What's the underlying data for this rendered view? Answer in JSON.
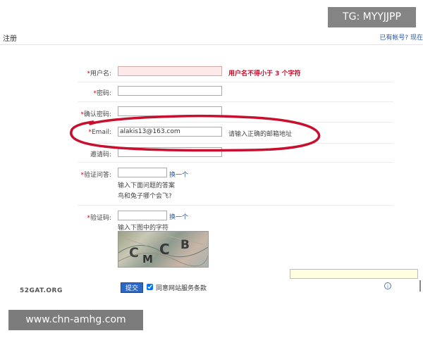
{
  "header": {
    "title": "注册",
    "links": "已有帐号? 现在"
  },
  "form": {
    "username": {
      "label": "用户名:",
      "required": "*",
      "value": "",
      "error": "用户名不得小于 3 个字符"
    },
    "password": {
      "label": "密码:",
      "required": "*",
      "value": ""
    },
    "confirm": {
      "label": "确认密码:",
      "required": "*",
      "value": ""
    },
    "email": {
      "label": "Email:",
      "required": "*",
      "value": "alakis13@163.com",
      "hint": "请输入正确的邮箱地址"
    },
    "invite": {
      "label": "邀请码:",
      "value": ""
    },
    "question": {
      "label": "验证问答:",
      "required": "*",
      "value": "",
      "switch": "换一个",
      "hint": "输入下面问题的答案",
      "text": "鸟和兔子哪个会飞?"
    },
    "captcha": {
      "label": "验证码:",
      "required": "*",
      "value": "",
      "switch": "换一个",
      "hint": "输入下图中的字符",
      "chars": [
        "C",
        "M",
        "C",
        "B"
      ]
    },
    "submit_label": "提交",
    "agree_label": "同意网站服务条款",
    "agree_checked": true
  },
  "annotation_color": "#c8102e",
  "watermark_tg": "TG: MYYJJPP",
  "watermark_site": "52GAT.ORG",
  "watermark_url": "www.chn-amhg.com",
  "info_icon_glyph": "i"
}
